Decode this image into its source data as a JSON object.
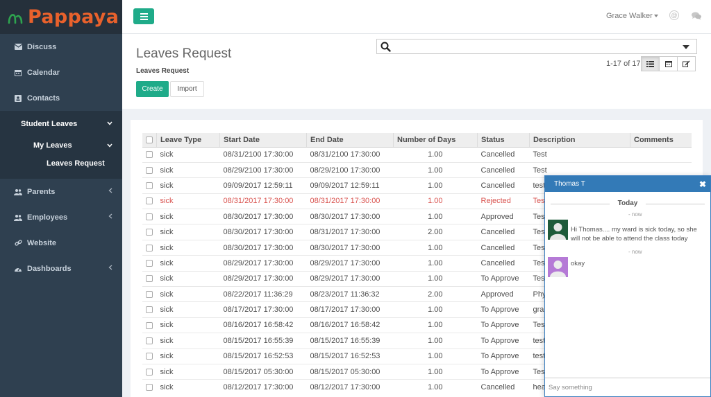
{
  "brand": {
    "name": "Pappaya",
    "accent": "#e8612c"
  },
  "sidebar": {
    "items": [
      {
        "label": "Discuss",
        "icon": "envelope-icon"
      },
      {
        "label": "Calendar",
        "icon": "calendar-icon"
      },
      {
        "label": "Contacts",
        "icon": "address-book-icon"
      },
      {
        "label": "Student Leaves",
        "icon": ""
      },
      {
        "label": "My Leaves",
        "icon": ""
      },
      {
        "label": "Leaves Request",
        "icon": ""
      },
      {
        "label": "Parents",
        "icon": "users-icon"
      },
      {
        "label": "Employees",
        "icon": "users-icon"
      },
      {
        "label": "Website",
        "icon": "link-icon"
      },
      {
        "label": "Dashboards",
        "icon": "dashboard-icon"
      }
    ]
  },
  "topbar": {
    "user_name": "Grace Walker"
  },
  "control": {
    "title": "Leaves Request",
    "breadcrumb": "Leaves Request",
    "create_label": "Create",
    "import_label": "Import",
    "search_placeholder": "",
    "pager": "1-17 of 17"
  },
  "table": {
    "columns": [
      "Leave Type",
      "Start Date",
      "End Date",
      "Number of Days",
      "Status",
      "Description",
      "Comments"
    ],
    "rows": [
      [
        "sick",
        "08/31/2100 17:30:00",
        "08/31/2100 17:30:00",
        "1.00",
        "Cancelled",
        "Test",
        ""
      ],
      [
        "sick",
        "08/29/2100 17:30:00",
        "08/29/2100 17:30:00",
        "1.00",
        "Cancelled",
        "Test",
        ""
      ],
      [
        "sick",
        "09/09/2017 12:59:11",
        "09/09/2017 12:59:11",
        "1.00",
        "Cancelled",
        "test",
        ""
      ],
      [
        "sick",
        "08/31/2017 17:30:00",
        "08/31/2017 17:30:00",
        "1.00",
        "Rejected",
        "Test",
        ""
      ],
      [
        "sick",
        "08/30/2017 17:30:00",
        "08/30/2017 17:30:00",
        "1.00",
        "Approved",
        "Test",
        ""
      ],
      [
        "sick",
        "08/30/2017 17:30:00",
        "08/31/2017 17:30:00",
        "2.00",
        "Cancelled",
        "Test",
        ""
      ],
      [
        "sick",
        "08/30/2017 17:30:00",
        "08/30/2017 17:30:00",
        "1.00",
        "Cancelled",
        "Test",
        ""
      ],
      [
        "sick",
        "08/29/2017 17:30:00",
        "08/29/2017 17:30:00",
        "1.00",
        "Cancelled",
        "Test",
        ""
      ],
      [
        "sick",
        "08/29/2017 17:30:00",
        "08/29/2017 17:30:00",
        "1.00",
        "To Approve",
        "Test",
        ""
      ],
      [
        "sick",
        "08/22/2017 11:36:29",
        "08/23/2017 11:36:32",
        "2.00",
        "Approved",
        "Phy",
        ""
      ],
      [
        "sick",
        "08/17/2017 17:30:00",
        "08/17/2017 17:30:00",
        "1.00",
        "To Approve",
        "grar",
        ""
      ],
      [
        "sick",
        "08/16/2017 16:58:42",
        "08/16/2017 16:58:42",
        "1.00",
        "To Approve",
        "Test",
        ""
      ],
      [
        "sick",
        "08/15/2017 16:55:39",
        "08/15/2017 16:55:39",
        "1.00",
        "To Approve",
        "test",
        ""
      ],
      [
        "sick",
        "08/15/2017 16:52:53",
        "08/15/2017 16:52:53",
        "1.00",
        "To Approve",
        "test",
        ""
      ],
      [
        "sick",
        "08/15/2017 05:30:00",
        "08/15/2017 05:30:00",
        "1.00",
        "To Approve",
        "Test",
        ""
      ],
      [
        "sick",
        "08/12/2017 17:30:00",
        "08/12/2017 17:30:00",
        "1.00",
        "Cancelled",
        "hea",
        ""
      ]
    ],
    "danger_row": 3,
    "danger_color": "#d9534f"
  },
  "chat": {
    "title": "Thomas T",
    "day": "Today",
    "messages": [
      {
        "time": "- now",
        "text": "Hi Thomas.... my ward is sick today, so she will not be able to attend the class today",
        "avatar": "green-avatar-icon"
      },
      {
        "time": "- now",
        "text": "okay",
        "avatar": "purple-avatar-icon"
      }
    ],
    "input_placeholder": "Say something",
    "header_color": "#337ab7"
  }
}
